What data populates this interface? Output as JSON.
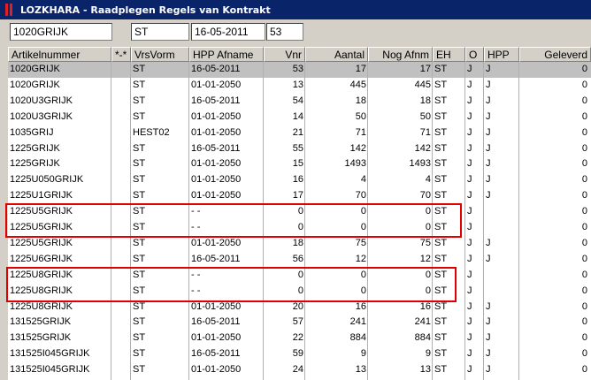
{
  "window": {
    "title": "LOZKHARA - Raadplegen Regels van Kontrakt"
  },
  "filters": {
    "article": "1020GRIJK",
    "vrsvorm": "ST",
    "date": "16-05-2011",
    "number": "53"
  },
  "columns": [
    "Artikelnummer",
    "*-*",
    "VrsVorm",
    "HPP Afname",
    "Vnr",
    "Aantal",
    "Nog Afnm",
    "EH",
    "O",
    "HPP",
    "Geleverd"
  ],
  "rows": [
    {
      "art": "1020GRIJK",
      "star": "",
      "vrs": "ST",
      "date": "16-05-2011",
      "vnr": "53",
      "aantal": "17",
      "nog": "17",
      "eh": "ST",
      "o": "J",
      "hpp": "J",
      "gel": "0"
    },
    {
      "art": "1020GRIJK",
      "star": "",
      "vrs": "ST",
      "date": "01-01-2050",
      "vnr": "13",
      "aantal": "445",
      "nog": "445",
      "eh": "ST",
      "o": "J",
      "hpp": "J",
      "gel": "0"
    },
    {
      "art": "1020U3GRIJK",
      "star": "",
      "vrs": "ST",
      "date": "16-05-2011",
      "vnr": "54",
      "aantal": "18",
      "nog": "18",
      "eh": "ST",
      "o": "J",
      "hpp": "J",
      "gel": "0"
    },
    {
      "art": "1020U3GRIJK",
      "star": "",
      "vrs": "ST",
      "date": "01-01-2050",
      "vnr": "14",
      "aantal": "50",
      "nog": "50",
      "eh": "ST",
      "o": "J",
      "hpp": "J",
      "gel": "0"
    },
    {
      "art": "1035GRIJ",
      "star": "",
      "vrs": "HEST02",
      "date": "01-01-2050",
      "vnr": "21",
      "aantal": "71",
      "nog": "71",
      "eh": "ST",
      "o": "J",
      "hpp": "J",
      "gel": "0"
    },
    {
      "art": "1225GRIJK",
      "star": "",
      "vrs": "ST",
      "date": "16-05-2011",
      "vnr": "55",
      "aantal": "142",
      "nog": "142",
      "eh": "ST",
      "o": "J",
      "hpp": "J",
      "gel": "0"
    },
    {
      "art": "1225GRIJK",
      "star": "",
      "vrs": "ST",
      "date": "01-01-2050",
      "vnr": "15",
      "aantal": "1493",
      "nog": "1493",
      "eh": "ST",
      "o": "J",
      "hpp": "J",
      "gel": "0"
    },
    {
      "art": "1225U050GRIJK",
      "star": "",
      "vrs": "ST",
      "date": "01-01-2050",
      "vnr": "16",
      "aantal": "4",
      "nog": "4",
      "eh": "ST",
      "o": "J",
      "hpp": "J",
      "gel": "0"
    },
    {
      "art": "1225U1GRIJK",
      "star": "",
      "vrs": "ST",
      "date": "01-01-2050",
      "vnr": "17",
      "aantal": "70",
      "nog": "70",
      "eh": "ST",
      "o": "J",
      "hpp": "J",
      "gel": "0"
    },
    {
      "art": "1225U5GRIJK",
      "star": "",
      "vrs": "ST",
      "date": "- -",
      "vnr": "0",
      "aantal": "0",
      "nog": "0",
      "eh": "ST",
      "o": "J",
      "hpp": "",
      "gel": "0"
    },
    {
      "art": "1225U5GRIJK",
      "star": "",
      "vrs": "ST",
      "date": "- -",
      "vnr": "0",
      "aantal": "0",
      "nog": "0",
      "eh": "ST",
      "o": "J",
      "hpp": "",
      "gel": "0"
    },
    {
      "art": "1225U5GRIJK",
      "star": "",
      "vrs": "ST",
      "date": "01-01-2050",
      "vnr": "18",
      "aantal": "75",
      "nog": "75",
      "eh": "ST",
      "o": "J",
      "hpp": "J",
      "gel": "0"
    },
    {
      "art": "1225U6GRIJK",
      "star": "",
      "vrs": "ST",
      "date": "16-05-2011",
      "vnr": "56",
      "aantal": "12",
      "nog": "12",
      "eh": "ST",
      "o": "J",
      "hpp": "J",
      "gel": "0"
    },
    {
      "art": "1225U8GRIJK",
      "star": "",
      "vrs": "ST",
      "date": "- -",
      "vnr": "0",
      "aantal": "0",
      "nog": "0",
      "eh": "ST",
      "o": "J",
      "hpp": "",
      "gel": "0"
    },
    {
      "art": "1225U8GRIJK",
      "star": "",
      "vrs": "ST",
      "date": "- -",
      "vnr": "0",
      "aantal": "0",
      "nog": "0",
      "eh": "ST",
      "o": "J",
      "hpp": "",
      "gel": "0"
    },
    {
      "art": "1225U8GRIJK",
      "star": "",
      "vrs": "ST",
      "date": "01-01-2050",
      "vnr": "20",
      "aantal": "16",
      "nog": "16",
      "eh": "ST",
      "o": "J",
      "hpp": "J",
      "gel": "0"
    },
    {
      "art": "131525GRIJK",
      "star": "",
      "vrs": "ST",
      "date": "16-05-2011",
      "vnr": "57",
      "aantal": "241",
      "nog": "241",
      "eh": "ST",
      "o": "J",
      "hpp": "J",
      "gel": "0"
    },
    {
      "art": "131525GRIJK",
      "star": "",
      "vrs": "ST",
      "date": "01-01-2050",
      "vnr": "22",
      "aantal": "884",
      "nog": "884",
      "eh": "ST",
      "o": "J",
      "hpp": "J",
      "gel": "0"
    },
    {
      "art": "131525I045GRIJK",
      "star": "",
      "vrs": "ST",
      "date": "16-05-2011",
      "vnr": "59",
      "aantal": "9",
      "nog": "9",
      "eh": "ST",
      "o": "J",
      "hpp": "J",
      "gel": "0"
    },
    {
      "art": "131525I045GRIJK",
      "star": "",
      "vrs": "ST",
      "date": "01-01-2050",
      "vnr": "24",
      "aantal": "13",
      "nog": "13",
      "eh": "ST",
      "o": "J",
      "hpp": "J",
      "gel": "0"
    }
  ]
}
